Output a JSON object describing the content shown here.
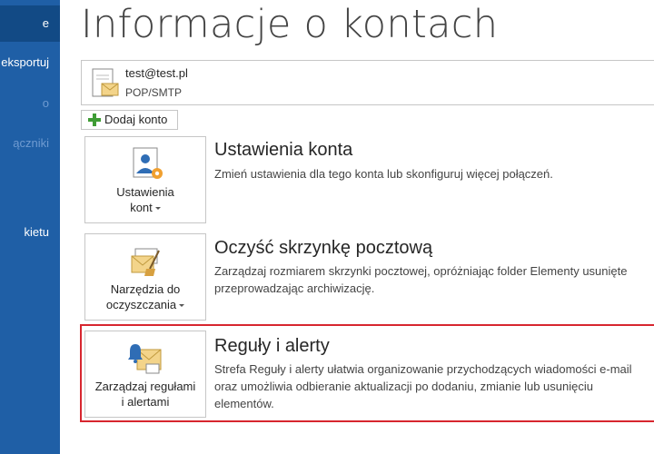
{
  "nav": {
    "items": [
      {
        "label": "e",
        "state": "active"
      },
      {
        "label": "eksportuj",
        "state": "normal"
      },
      {
        "label": "o",
        "state": "dim"
      },
      {
        "label": "ączniki",
        "state": "dim"
      },
      {
        "label": "kietu",
        "state": "normal"
      }
    ]
  },
  "page": {
    "title": "Informacje o kontach"
  },
  "account": {
    "email": "test@test.pl",
    "type": "POP/SMTP"
  },
  "add_account": {
    "label": "Dodaj konto"
  },
  "sections": [
    {
      "tile_line1": "Ustawienia",
      "tile_line2": "kont",
      "title": "Ustawienia konta",
      "desc1": "Zmień ustawienia dla tego konta lub skonfiguruj więcej połączeń.",
      "desc2": "",
      "desc3": ""
    },
    {
      "tile_line1": "Narzędzia do",
      "tile_line2": "oczyszczania",
      "title": "Oczyść skrzynkę pocztową",
      "desc1": "Zarządzaj rozmiarem skrzynki pocztowej, opróżniając folder Elementy usunięte",
      "desc2": "przeprowadzając archiwizację.",
      "desc3": ""
    },
    {
      "tile_line1": "Zarządzaj regułami",
      "tile_line2": "i alertami",
      "title": "Reguły i alerty",
      "desc1": "Strefa Reguły i alerty ułatwia organizowanie przychodzących wiadomości e-mail",
      "desc2": "oraz umożliwia odbieranie aktualizacji po dodaniu, zmianie lub usunięciu",
      "desc3": "elementów."
    }
  ],
  "colors": {
    "nav_bg": "#1f5fa6",
    "nav_active": "#124a85",
    "highlight_border": "#d7262f",
    "plus_green": "#3f9c35"
  }
}
